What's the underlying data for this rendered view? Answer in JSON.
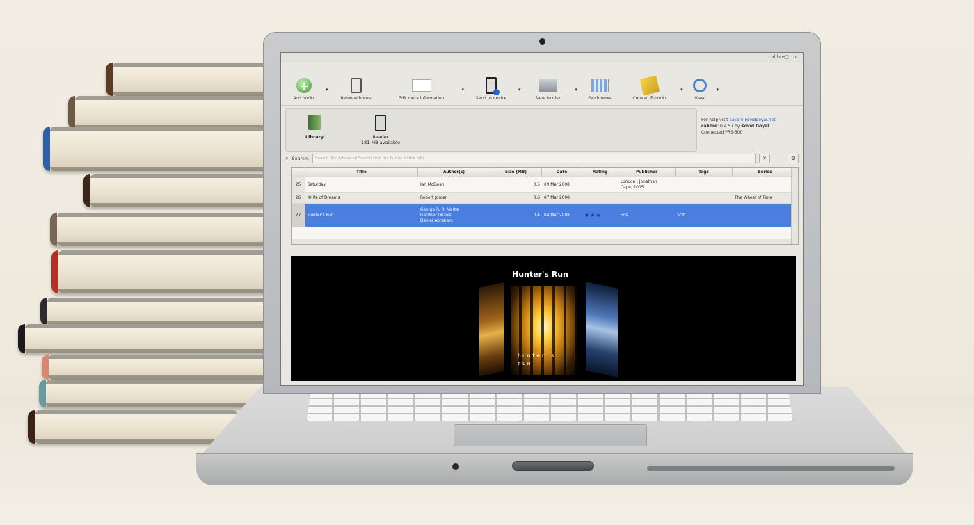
{
  "window": {
    "title": "calibre",
    "controls": "- □ ×"
  },
  "toolbar": {
    "items": [
      {
        "label": "Add books",
        "icon": "add-icon"
      },
      {
        "label": "Remove books",
        "icon": "trash-icon"
      },
      {
        "label": "Edit meta information",
        "icon": "metadata-icon"
      },
      {
        "label": "Send to device",
        "icon": "device-icon"
      },
      {
        "label": "Save to disk",
        "icon": "disk-icon"
      },
      {
        "label": "Fetch news",
        "icon": "news-icon"
      },
      {
        "label": "Convert E-books",
        "icon": "convert-icon"
      },
      {
        "label": "View",
        "icon": "magnifier-icon"
      }
    ],
    "chevron": "▾"
  },
  "locations": {
    "library": {
      "label": "Library"
    },
    "reader": {
      "label": "Reader",
      "sub": "181 MB available"
    }
  },
  "info": {
    "help_prefix": "For help visit ",
    "help_link": "calibre.kovidgoyal.net",
    "version_name": "calibre",
    "version_rest": ": 0.4.57 by ",
    "author": "Kovid Goyal",
    "connected": "Connected PRS-500"
  },
  "search": {
    "label": "Search:",
    "placeholder": "Search (For Advanced Search click the button to the left)"
  },
  "table": {
    "headers": [
      "",
      "Title",
      "Author(s)",
      "Size (MB)",
      "Date",
      "Rating",
      "Publisher",
      "Tags",
      "Series"
    ],
    "rows": [
      {
        "num": "25",
        "title": "Saturday",
        "authors": [
          "Ian McEwan"
        ],
        "size": "0.5",
        "date": "09 Mar 2008",
        "rating": "",
        "publisher": [
          "London : Jonathan",
          "Cape, 2005."
        ],
        "tags": "",
        "series": ""
      },
      {
        "num": "26",
        "title": "Knife of Dreams",
        "authors": [
          "Robert Jordan"
        ],
        "size": "0.6",
        "date": "07 Mar 2008",
        "rating": "",
        "publisher": [
          ""
        ],
        "tags": "",
        "series": "The Wheel of Time"
      },
      {
        "num": "27",
        "title": "Hunter's Run",
        "authors": [
          "George R. R. Martin",
          "Gardner Dozois",
          "Daniel Abraham"
        ],
        "size": "0.4",
        "date": "04 Mar 2008",
        "rating": "★★★",
        "publisher": [
          "Eos"
        ],
        "tags": "scifi",
        "series": ""
      }
    ]
  },
  "coverflow": {
    "title": "Hunter's Run",
    "caption_line1": "hunter's",
    "caption_line2": "run"
  },
  "colors": {
    "selection": "#4a7fe0",
    "link": "#2450c7"
  }
}
